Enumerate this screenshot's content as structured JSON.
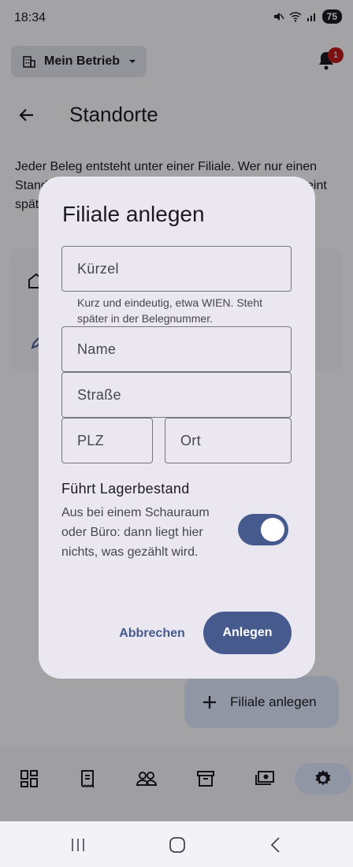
{
  "status_bar": {
    "time": "18:34",
    "battery": "75"
  },
  "header": {
    "business_chip_label": "Mein Betrieb",
    "notification_count": "1"
  },
  "page": {
    "title": "Standorte",
    "intro": "Jeder Beleg entsteht unter einer Filiale. Wer nur einen Standort hat, legt nur einen an. Filiale — dann erscheint später auch auf Belegen darum"
  },
  "fab": {
    "label": "Filiale anlegen"
  },
  "dialog": {
    "title": "Filiale anlegen",
    "fields": {
      "kuerzel": {
        "label": "Kürzel",
        "helper": "Kurz und eindeutig, etwa WIEN. Steht später in der Belegnummer."
      },
      "name": {
        "label": "Name"
      },
      "strasse": {
        "label": "Straße"
      },
      "plz": {
        "label": "PLZ"
      },
      "ort": {
        "label": "Ort"
      }
    },
    "stock_toggle": {
      "title": "Führt Lagerbestand",
      "description": "Aus bei einem Schauraum oder Büro: dann liegt hier nichts, was gezählt wird.",
      "on": true
    },
    "actions": {
      "cancel": "Abbrechen",
      "confirm": "Anlegen"
    }
  },
  "bottom_nav": {
    "items": [
      "dashboard-icon",
      "receipt-icon",
      "people-icon",
      "archive-icon",
      "payments-icon",
      "settings-icon"
    ],
    "active": "settings-icon"
  },
  "colors": {
    "primary": "#465a8e",
    "dialog_bg": "#eae7f1",
    "badge": "#ba1a1a"
  }
}
